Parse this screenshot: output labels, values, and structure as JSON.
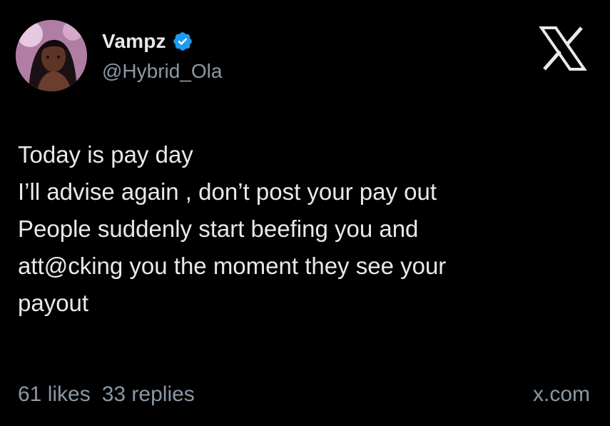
{
  "author": {
    "display_name": "Vampz",
    "handle": "@Hybrid_Ola",
    "verified": true,
    "verified_color": "#1d9bf0"
  },
  "tweet": {
    "lines": [
      "Today is pay day",
      "I’ll advise again , don’t post your pay out",
      "People suddenly start beefing you and",
      "att@cking you the moment they see your",
      "payout"
    ]
  },
  "stats": {
    "likes": "61 likes",
    "replies": "33 replies"
  },
  "source": "x.com",
  "icons": {
    "brand": "x-logo-icon",
    "verified": "verified-badge-icon"
  },
  "colors": {
    "background": "#000000",
    "primary_text": "#e7e9ea",
    "secondary_text": "#8b98a5"
  }
}
